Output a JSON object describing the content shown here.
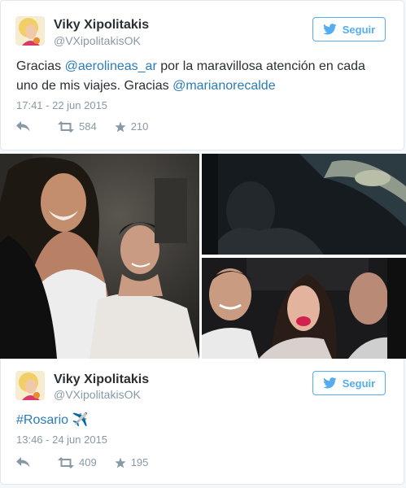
{
  "tweets": [
    {
      "author_name": "Viky Xipolitakis",
      "author_handle": "@VXipolitakisOK",
      "follow_label": "Seguir",
      "text_parts": [
        {
          "text": "Gracias ",
          "link": false
        },
        {
          "text": "@aerolineas_ar",
          "link": true
        },
        {
          "text": " por la maravillosa atención en cada uno de mis viajes. Gracias ",
          "link": false
        },
        {
          "text": "@marianorecalde",
          "link": true
        }
      ],
      "timestamp": "17:41 - 22 jun 2015",
      "retweets": "584",
      "favorites": "210"
    },
    {
      "author_name": "Viky Xipolitakis",
      "author_handle": "@VXipolitakisOK",
      "follow_label": "Seguir",
      "hashtag": "#Rosario",
      "emoji": "✈️",
      "timestamp": "13:46 - 24 jun 2015",
      "retweets": "409",
      "favorites": "195"
    }
  ],
  "colors": {
    "link": "#2b7bb9",
    "follow": "#55acee",
    "muted": "#8899a6",
    "border": "#e1e8ed"
  },
  "icons": [
    "twitter-bird-icon",
    "reply-icon",
    "retweet-icon",
    "favorite-star-icon",
    "airplane-emoji"
  ]
}
